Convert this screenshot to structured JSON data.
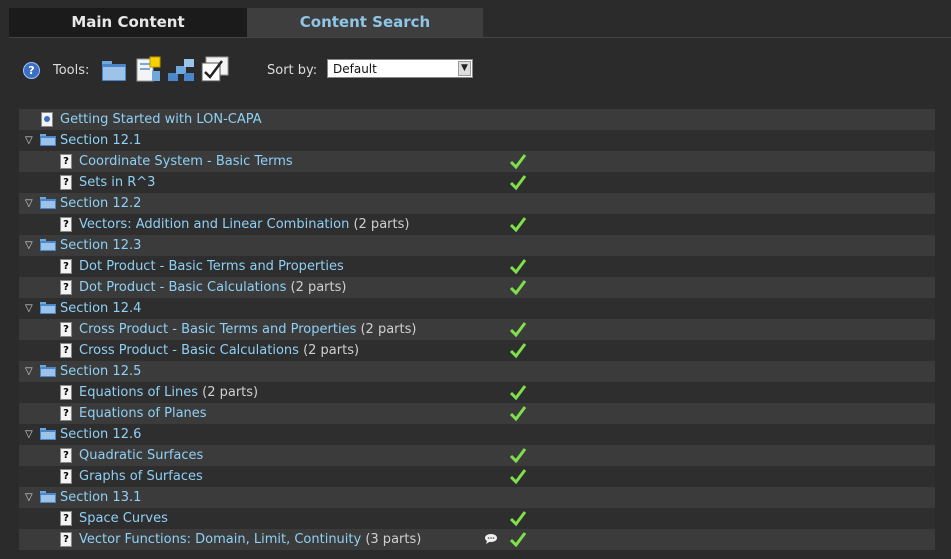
{
  "tabs": {
    "main": "Main Content",
    "search": "Content Search"
  },
  "toolbar": {
    "help": "?",
    "tools_label": "Tools:",
    "sort_label": "Sort by:",
    "sort_value": "Default",
    "tool_icons": [
      "folder-icon",
      "document-icon",
      "network-icon",
      "checklist-icon"
    ]
  },
  "toc": {
    "top": {
      "label": "Getting Started with LON-CAPA"
    },
    "r1": {
      "label": "Section 12.1"
    },
    "r2": {
      "label": "Coordinate System - Basic Terms",
      "parts": ""
    },
    "r3": {
      "label": "Sets in R^3",
      "parts": ""
    },
    "r4": {
      "label": "Section 12.2"
    },
    "r5": {
      "label": "Vectors: Addition and Linear Combination",
      "parts": " (2 parts)"
    },
    "r6": {
      "label": "Section 12.3"
    },
    "r7": {
      "label": "Dot Product - Basic Terms and Properties",
      "parts": ""
    },
    "r8": {
      "label": "Dot Product - Basic Calculations",
      "parts": " (2 parts)"
    },
    "r9": {
      "label": "Section 12.4"
    },
    "r10": {
      "label": "Cross Product - Basic Terms and Properties",
      "parts": " (2 parts)"
    },
    "r11": {
      "label": "Cross Product - Basic Calculations",
      "parts": " (2 parts)"
    },
    "r12": {
      "label": "Section 12.5"
    },
    "r13": {
      "label": "Equations of Lines",
      "parts": " (2 parts)"
    },
    "r14": {
      "label": "Equations of Planes",
      "parts": ""
    },
    "r15": {
      "label": "Section 12.6"
    },
    "r16": {
      "label": "Quadratic Surfaces",
      "parts": ""
    },
    "r17": {
      "label": "Graphs of Surfaces",
      "parts": ""
    },
    "r18": {
      "label": "Section 13.1"
    },
    "r19": {
      "label": "Space Curves",
      "parts": ""
    },
    "r20": {
      "label": "Vector Functions: Domain, Limit, Continuity",
      "parts": " (3 parts)"
    }
  },
  "colors": {
    "link": "#8fd0f5",
    "check": "#7ee04a",
    "row_light": "#3b3b3b",
    "row_dark": "#2e2e2e"
  }
}
